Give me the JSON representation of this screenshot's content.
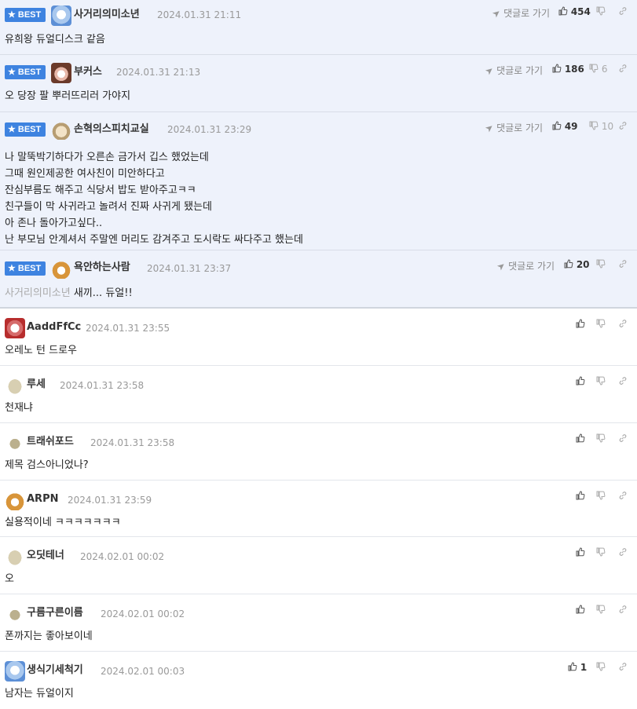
{
  "comments": [
    {
      "best": true,
      "badge": "BEST",
      "nick": "사거리의미소년",
      "date": "2024.01.31 21:11",
      "reply": "댓글로 가기",
      "up": "454",
      "down": "",
      "lines": [
        "유희왕 듀얼디스크 같음"
      ]
    },
    {
      "best": true,
      "badge": "BEST",
      "nick": "부커스",
      "date": "2024.01.31 21:13",
      "reply": "댓글로 가기",
      "up": "186",
      "down": "6",
      "lines": [
        "오 당장 팔 뿌러뜨리러 가야지"
      ]
    },
    {
      "best": true,
      "badge": "BEST",
      "nick": "손혁의스피치교실",
      "date": "2024.01.31 23:29",
      "reply": "댓글로 가기",
      "up": "49",
      "down": "10",
      "lines": [
        "나 말뚝박기하다가 오른손 금가서 깁스 했었는데",
        "그때 원인제공한 여사친이 미안하다고",
        "잔심부름도 해주고 식당서 밥도 받아주고ㅋㅋ",
        "친구들이 막 사귀라고 놀려서 진짜 사귀게 됐는데",
        "아 존나 돌아가고싶다..",
        "난 부모님 안계셔서 주말엔 머리도 감겨주고 도시락도 싸다주고 했는데"
      ]
    },
    {
      "best": true,
      "badge": "BEST",
      "nick": "욕안하는사람",
      "date": "2024.01.31 23:37",
      "reply": "댓글로 가기",
      "up": "20",
      "down": "",
      "mention": "사거리의미소년",
      "lines": [
        "새끼... 듀얼!!"
      ]
    },
    {
      "best": false,
      "nick": "AaddFfCc",
      "date": "2024.01.31 23:55",
      "up": "",
      "down": "",
      "lines": [
        "오레노 턴 드로우"
      ]
    },
    {
      "best": false,
      "nick": "루세",
      "date": "2024.01.31 23:58",
      "up": "",
      "down": "",
      "lines": [
        "천재냐"
      ]
    },
    {
      "best": false,
      "nick": "트래쉬포드",
      "date": "2024.01.31 23:58",
      "up": "",
      "down": "",
      "lines": [
        "제목 검스아니었나?"
      ]
    },
    {
      "best": false,
      "nick": "ARPN",
      "date": "2024.01.31 23:59",
      "up": "",
      "down": "",
      "lines": [
        "실용적이네 ㅋㅋㅋㅋㅋㅋㅋ"
      ]
    },
    {
      "best": false,
      "nick": "오딧테너",
      "date": "2024.02.01 00:02",
      "up": "",
      "down": "",
      "lines": [
        "오"
      ]
    },
    {
      "best": false,
      "nick": "구름구른이름",
      "date": "2024.02.01 00:02",
      "up": "",
      "down": "",
      "lines": [
        "폰까지는 좋아보이네"
      ]
    },
    {
      "best": false,
      "nick": "생식기세척기",
      "date": "2024.02.01 00:03",
      "up": "1",
      "down": "",
      "lines": [
        "남자는 듀얼이지"
      ]
    }
  ]
}
